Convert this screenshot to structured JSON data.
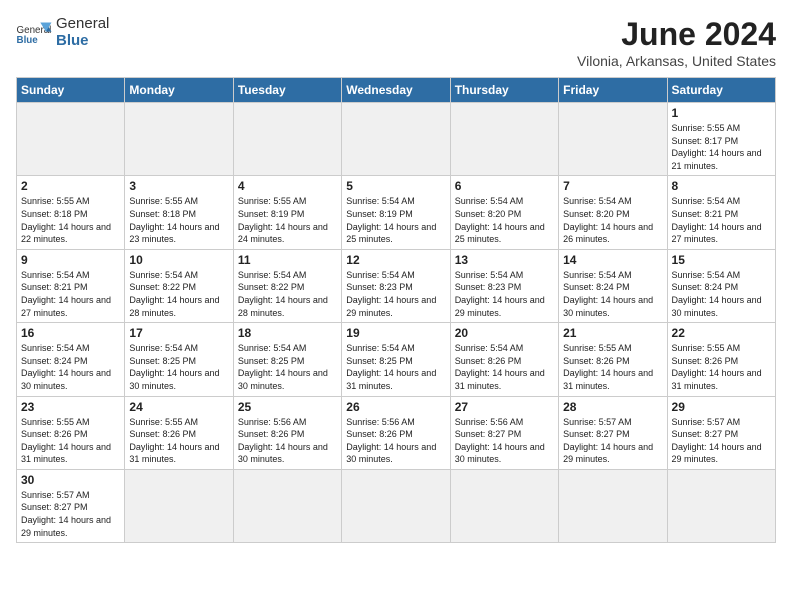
{
  "header": {
    "logo_general": "General",
    "logo_blue": "Blue",
    "month_year": "June 2024",
    "location": "Vilonia, Arkansas, United States"
  },
  "weekdays": [
    "Sunday",
    "Monday",
    "Tuesday",
    "Wednesday",
    "Thursday",
    "Friday",
    "Saturday"
  ],
  "weeks": [
    [
      {
        "day": "",
        "info": ""
      },
      {
        "day": "",
        "info": ""
      },
      {
        "day": "",
        "info": ""
      },
      {
        "day": "",
        "info": ""
      },
      {
        "day": "",
        "info": ""
      },
      {
        "day": "",
        "info": ""
      },
      {
        "day": "1",
        "info": "Sunrise: 5:55 AM\nSunset: 8:17 PM\nDaylight: 14 hours and 21 minutes."
      }
    ],
    [
      {
        "day": "2",
        "info": "Sunrise: 5:55 AM\nSunset: 8:18 PM\nDaylight: 14 hours and 22 minutes."
      },
      {
        "day": "3",
        "info": "Sunrise: 5:55 AM\nSunset: 8:18 PM\nDaylight: 14 hours and 23 minutes."
      },
      {
        "day": "4",
        "info": "Sunrise: 5:55 AM\nSunset: 8:19 PM\nDaylight: 14 hours and 24 minutes."
      },
      {
        "day": "5",
        "info": "Sunrise: 5:54 AM\nSunset: 8:19 PM\nDaylight: 14 hours and 25 minutes."
      },
      {
        "day": "6",
        "info": "Sunrise: 5:54 AM\nSunset: 8:20 PM\nDaylight: 14 hours and 25 minutes."
      },
      {
        "day": "7",
        "info": "Sunrise: 5:54 AM\nSunset: 8:20 PM\nDaylight: 14 hours and 26 minutes."
      },
      {
        "day": "8",
        "info": "Sunrise: 5:54 AM\nSunset: 8:21 PM\nDaylight: 14 hours and 27 minutes."
      }
    ],
    [
      {
        "day": "9",
        "info": "Sunrise: 5:54 AM\nSunset: 8:21 PM\nDaylight: 14 hours and 27 minutes."
      },
      {
        "day": "10",
        "info": "Sunrise: 5:54 AM\nSunset: 8:22 PM\nDaylight: 14 hours and 28 minutes."
      },
      {
        "day": "11",
        "info": "Sunrise: 5:54 AM\nSunset: 8:22 PM\nDaylight: 14 hours and 28 minutes."
      },
      {
        "day": "12",
        "info": "Sunrise: 5:54 AM\nSunset: 8:23 PM\nDaylight: 14 hours and 29 minutes."
      },
      {
        "day": "13",
        "info": "Sunrise: 5:54 AM\nSunset: 8:23 PM\nDaylight: 14 hours and 29 minutes."
      },
      {
        "day": "14",
        "info": "Sunrise: 5:54 AM\nSunset: 8:24 PM\nDaylight: 14 hours and 30 minutes."
      },
      {
        "day": "15",
        "info": "Sunrise: 5:54 AM\nSunset: 8:24 PM\nDaylight: 14 hours and 30 minutes."
      }
    ],
    [
      {
        "day": "16",
        "info": "Sunrise: 5:54 AM\nSunset: 8:24 PM\nDaylight: 14 hours and 30 minutes."
      },
      {
        "day": "17",
        "info": "Sunrise: 5:54 AM\nSunset: 8:25 PM\nDaylight: 14 hours and 30 minutes."
      },
      {
        "day": "18",
        "info": "Sunrise: 5:54 AM\nSunset: 8:25 PM\nDaylight: 14 hours and 30 minutes."
      },
      {
        "day": "19",
        "info": "Sunrise: 5:54 AM\nSunset: 8:25 PM\nDaylight: 14 hours and 31 minutes."
      },
      {
        "day": "20",
        "info": "Sunrise: 5:54 AM\nSunset: 8:26 PM\nDaylight: 14 hours and 31 minutes."
      },
      {
        "day": "21",
        "info": "Sunrise: 5:55 AM\nSunset: 8:26 PM\nDaylight: 14 hours and 31 minutes."
      },
      {
        "day": "22",
        "info": "Sunrise: 5:55 AM\nSunset: 8:26 PM\nDaylight: 14 hours and 31 minutes."
      }
    ],
    [
      {
        "day": "23",
        "info": "Sunrise: 5:55 AM\nSunset: 8:26 PM\nDaylight: 14 hours and 31 minutes."
      },
      {
        "day": "24",
        "info": "Sunrise: 5:55 AM\nSunset: 8:26 PM\nDaylight: 14 hours and 31 minutes."
      },
      {
        "day": "25",
        "info": "Sunrise: 5:56 AM\nSunset: 8:26 PM\nDaylight: 14 hours and 30 minutes."
      },
      {
        "day": "26",
        "info": "Sunrise: 5:56 AM\nSunset: 8:26 PM\nDaylight: 14 hours and 30 minutes."
      },
      {
        "day": "27",
        "info": "Sunrise: 5:56 AM\nSunset: 8:27 PM\nDaylight: 14 hours and 30 minutes."
      },
      {
        "day": "28",
        "info": "Sunrise: 5:57 AM\nSunset: 8:27 PM\nDaylight: 14 hours and 29 minutes."
      },
      {
        "day": "29",
        "info": "Sunrise: 5:57 AM\nSunset: 8:27 PM\nDaylight: 14 hours and 29 minutes."
      }
    ],
    [
      {
        "day": "30",
        "info": "Sunrise: 5:57 AM\nSunset: 8:27 PM\nDaylight: 14 hours and 29 minutes."
      },
      {
        "day": "",
        "info": ""
      },
      {
        "day": "",
        "info": ""
      },
      {
        "day": "",
        "info": ""
      },
      {
        "day": "",
        "info": ""
      },
      {
        "day": "",
        "info": ""
      },
      {
        "day": "",
        "info": ""
      }
    ]
  ]
}
